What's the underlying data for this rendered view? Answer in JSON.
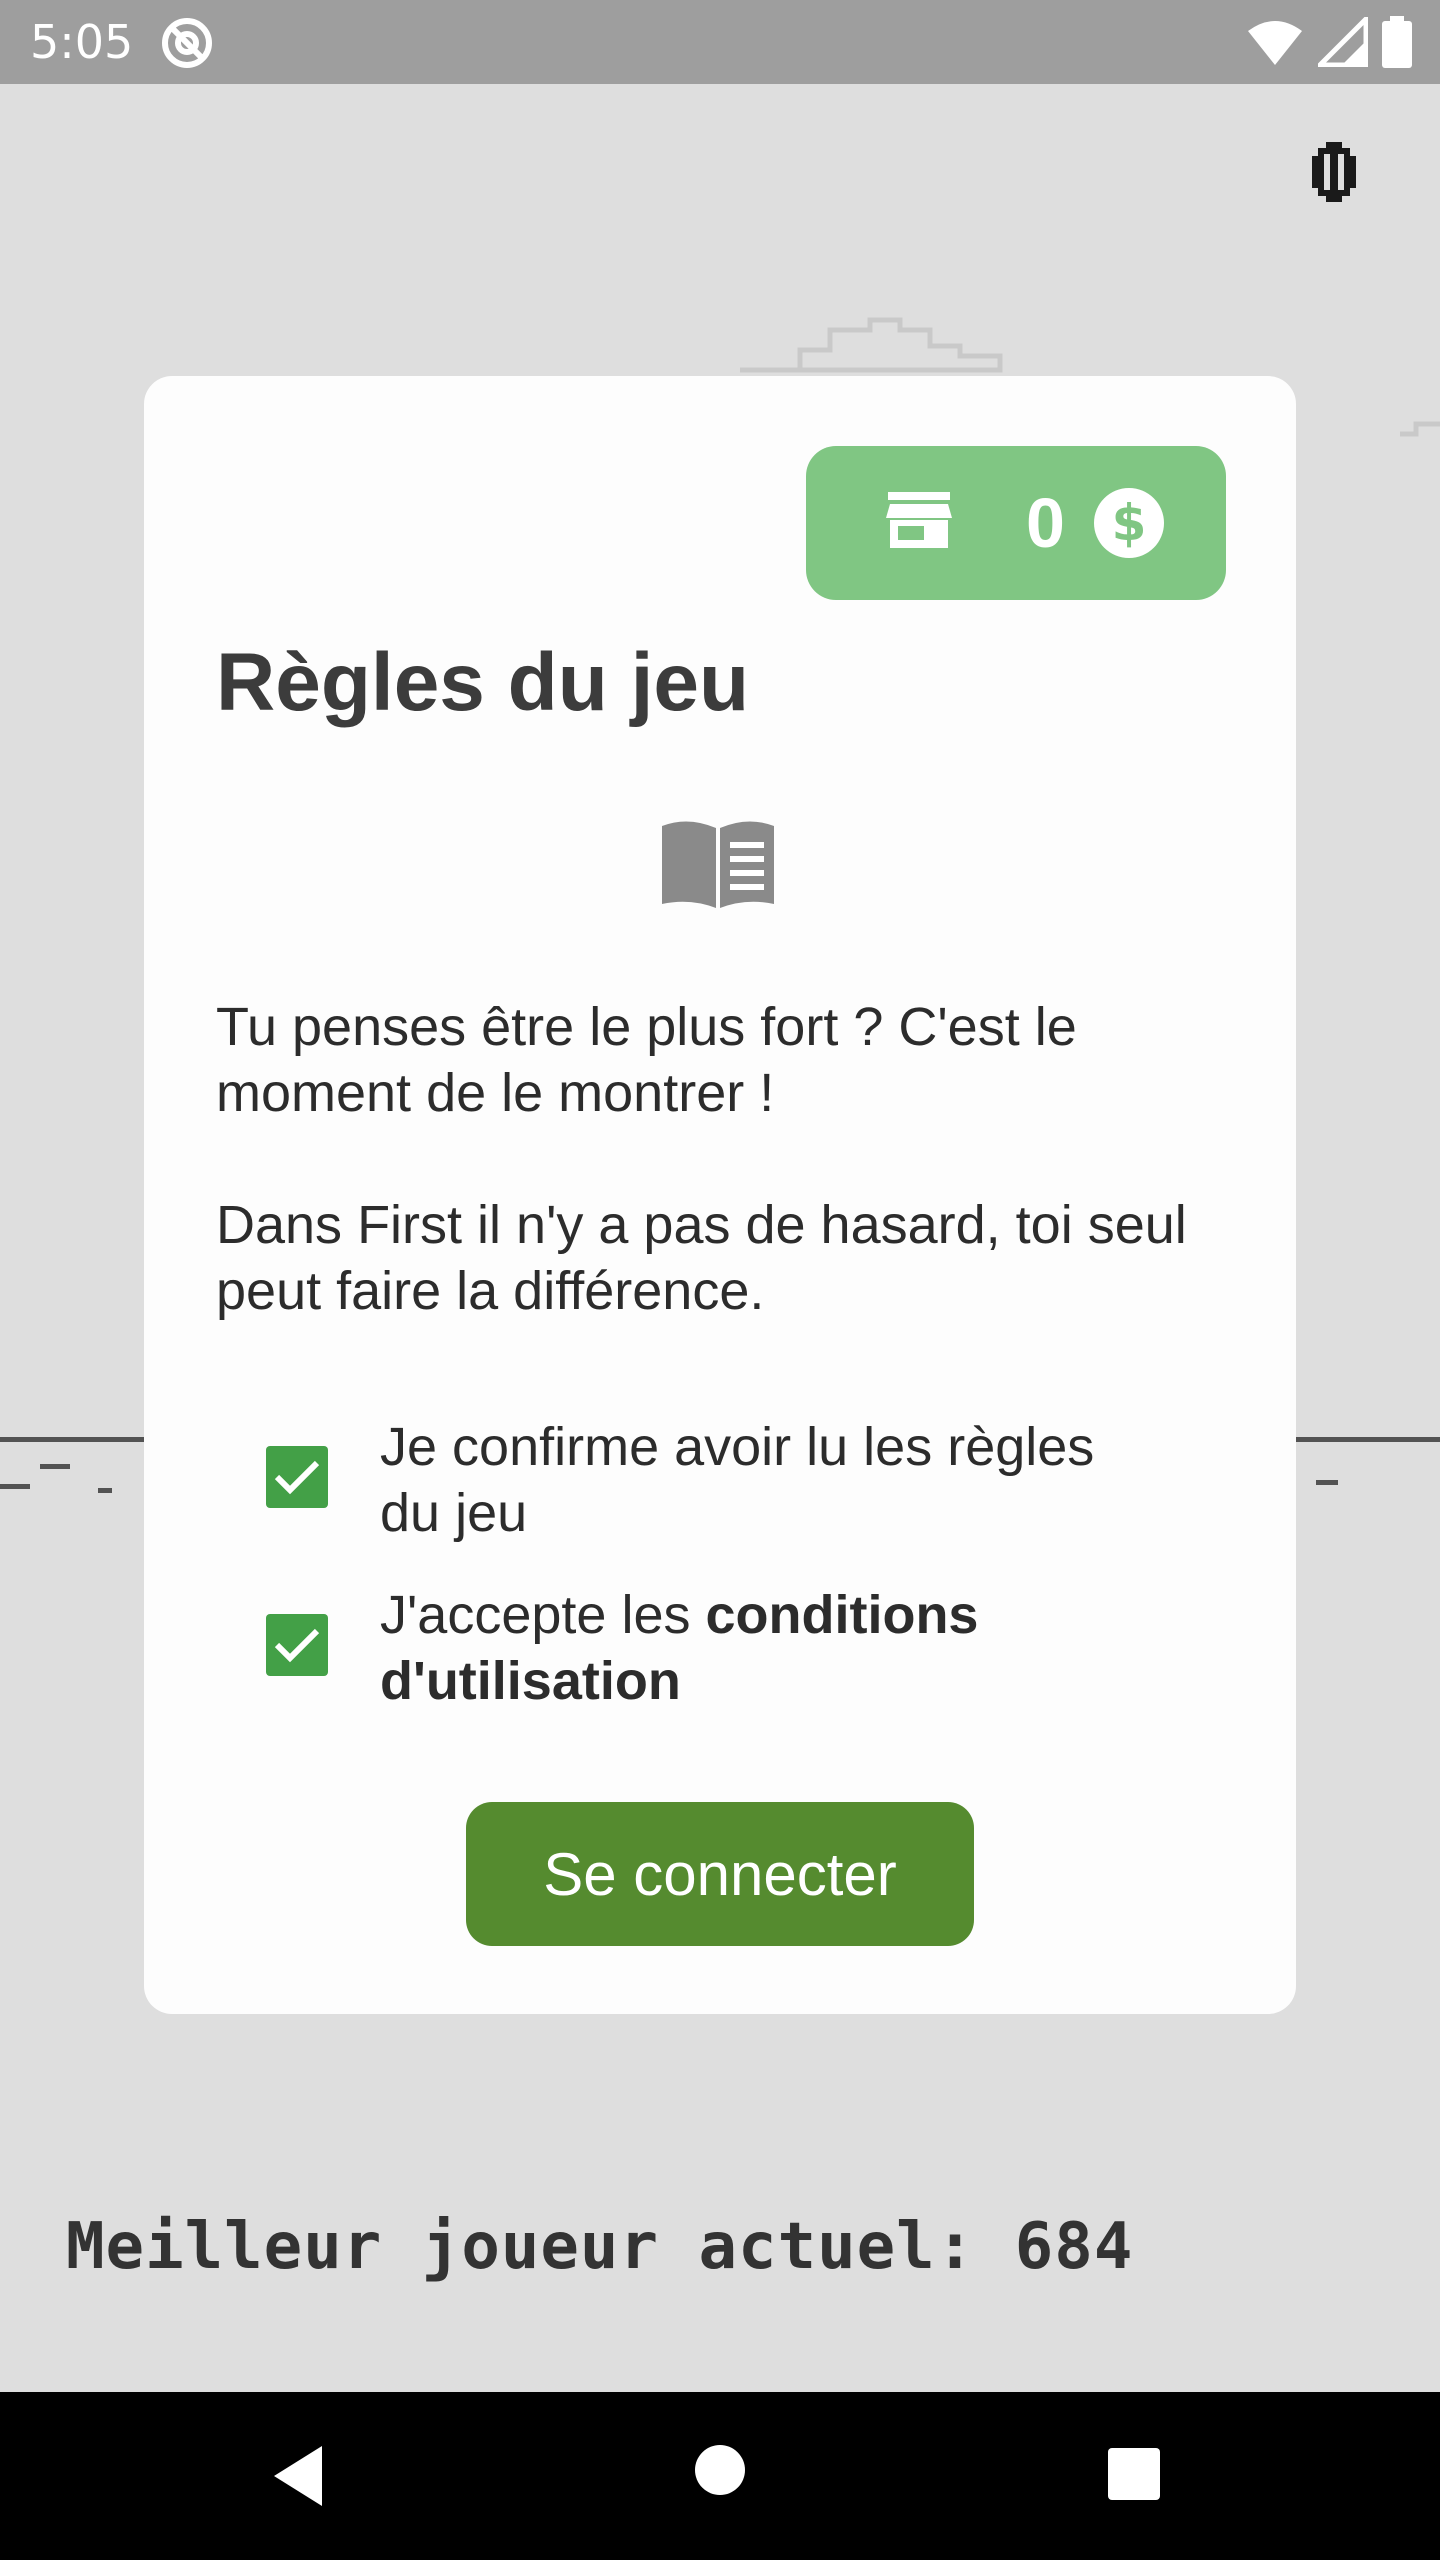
{
  "status_bar": {
    "time": "5:05",
    "icons": [
      "at-sign-icon",
      "wifi-icon",
      "signal-icon",
      "battery-icon"
    ]
  },
  "game": {
    "best_player_label": "Meilleur joueur actuel: 684",
    "pause_icon": "pause-icon"
  },
  "dialog": {
    "coins": {
      "store_icon": "store-icon",
      "value": "0",
      "currency_icon": "dollar-coin-icon",
      "color": "#80c683"
    },
    "title": "Règles du jeu",
    "book_icon": "book-open-icon",
    "paragraph_1": "Tu penses être le plus fort ? C'est le moment de le montrer !",
    "paragraph_2": "Dans First il n'y a pas de hasard, toi seul peut faire la différence.",
    "checkbox_1": {
      "label": "Je confirme avoir lu les règles du jeu",
      "checked": true
    },
    "checkbox_2": {
      "label_prefix": "J'accepte les ",
      "label_bold": "conditions d'utilisation",
      "checked": true
    },
    "connect_button": "Se connecter",
    "accent_color": "#558b2f",
    "checkbox_color": "#43a047"
  },
  "nav_bar": {
    "buttons": [
      "back-icon",
      "home-icon",
      "recents-icon"
    ]
  }
}
